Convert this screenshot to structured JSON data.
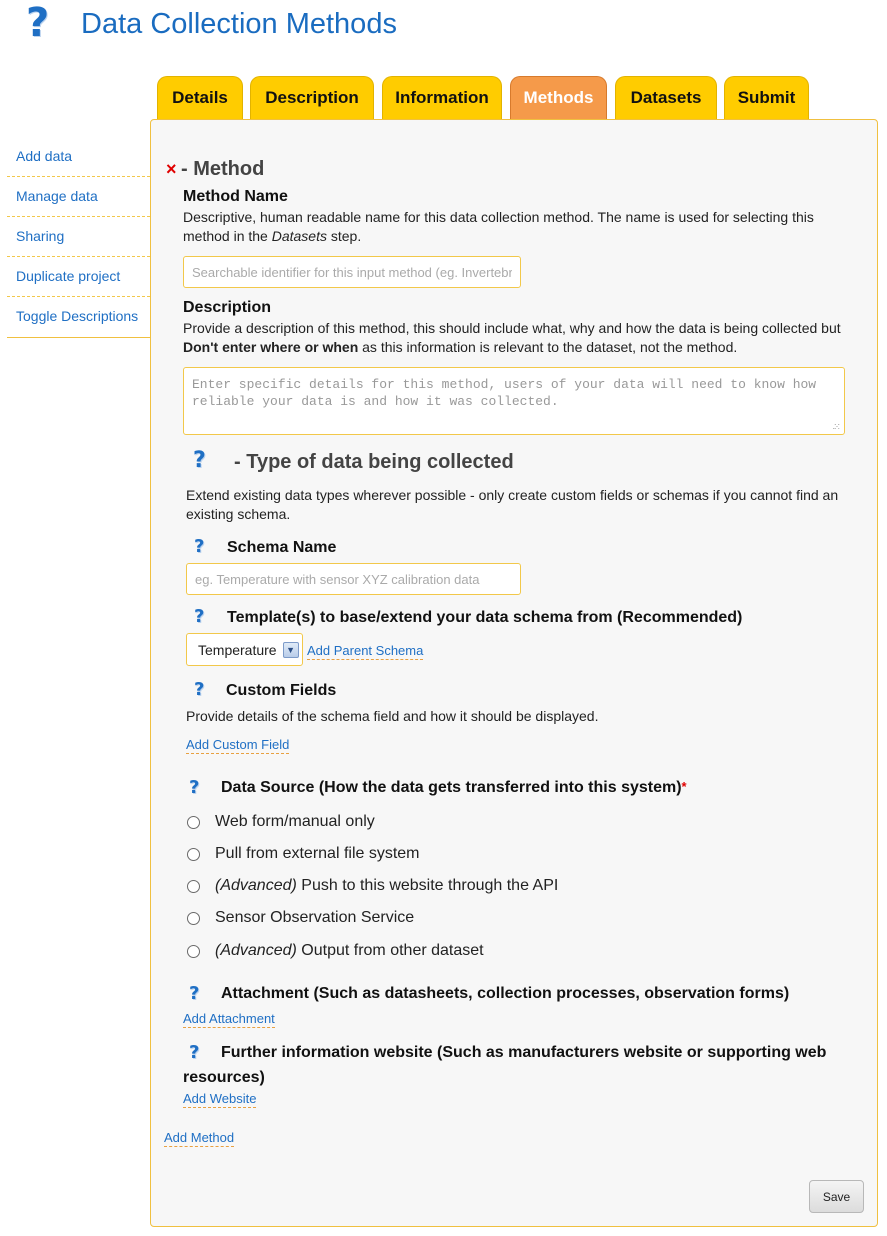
{
  "header": {
    "title": "Data Collection Methods",
    "help_glyph": "?"
  },
  "tabs": [
    {
      "label": "Details"
    },
    {
      "label": "Description"
    },
    {
      "label": "Information"
    },
    {
      "label": "Methods",
      "active": true
    },
    {
      "label": "Datasets"
    },
    {
      "label": "Submit"
    }
  ],
  "sidebar": {
    "items": [
      {
        "label": "Add data"
      },
      {
        "label": "Manage data"
      },
      {
        "label": "Sharing"
      },
      {
        "label": "Duplicate project"
      },
      {
        "label": "Toggle Descriptions"
      }
    ]
  },
  "method": {
    "remove_glyph": "×",
    "heading": "- Method",
    "name_label": "Method Name",
    "name_desc_1": "Descriptive, human readable name for this data collection method. The name is used for selecting this method in the ",
    "name_desc_em": "Datasets",
    "name_desc_2": " step.",
    "name_placeholder": "Searchable identifier for this input method (eg. Invertebrate observation)",
    "name_value": "",
    "description_label": "Description",
    "description_desc_1": "Provide a description of this method, this should include what, why and how the data is being collected but ",
    "description_desc_strong": "Don't enter where or when",
    "description_desc_2": " as this information is relevant to the dataset, not the method.",
    "description_placeholder": "Enter specific details for this method, users of your data will need to know how reliable your data is and how it was collected.",
    "description_value": ""
  },
  "data_type": {
    "heading": "- Type of data being collected",
    "intro": "Extend existing data types wherever possible - only create custom fields or schemas if you cannot find an existing schema.",
    "schema_name_label": "Schema Name",
    "schema_name_placeholder": "eg. Temperature with sensor XYZ calibration data",
    "schema_name_value": "",
    "template_label": "Template(s) to base/extend your data schema from (Recommended)",
    "template_selected": "Temperature",
    "add_parent_schema": "Add Parent Schema",
    "custom_fields_label": "Custom Fields",
    "custom_fields_desc": "Provide details of the schema field and how it should be displayed.",
    "add_custom_field": "Add Custom Field"
  },
  "data_source": {
    "label": "Data Source (How the data gets transferred into this system)",
    "required_mark": "*",
    "options": [
      {
        "prefix": "",
        "text": "Web form/manual only"
      },
      {
        "prefix": "",
        "text": "Pull from external file system"
      },
      {
        "prefix": "(Advanced)",
        "text": " Push to this website through the API"
      },
      {
        "prefix": "",
        "text": "Sensor Observation Service"
      },
      {
        "prefix": "(Advanced)",
        "text": " Output from other dataset"
      }
    ]
  },
  "attachment": {
    "label": "Attachment (Such as datasheets, collection processes, observation forms)",
    "add_link": "Add Attachment"
  },
  "website": {
    "label_line1": "Further information website (Such as manufacturers website or supporting web",
    "label_line2": "resources)",
    "add_link": "Add Website"
  },
  "footer": {
    "add_method": "Add Method",
    "save": "Save"
  },
  "colors": {
    "tab": "#ffcc00",
    "tab_active": "#f59a4a",
    "link": "#1f6fc4",
    "title": "#1a6cc0",
    "panel_border": "#f0c040"
  },
  "icons": {
    "help": "question-mark-icon",
    "remove": "close-x-icon",
    "select_arrow": "chevron-down-icon",
    "resize": "resize-grip-icon"
  }
}
